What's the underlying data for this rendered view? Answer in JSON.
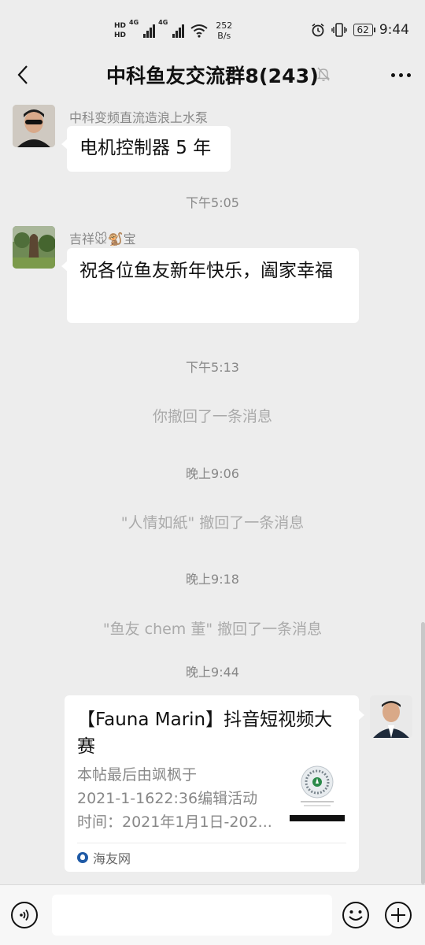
{
  "status_bar": {
    "hd1": "HD",
    "hd2": "HD",
    "net1": "4G",
    "net2": "4G",
    "speed_value": "252",
    "speed_unit": "B/s",
    "battery": "62",
    "time": "9:44",
    "icons": [
      "signal-icon",
      "wifi-icon",
      "alarm-icon",
      "vibrate-icon",
      "battery-icon"
    ]
  },
  "header": {
    "title": "中科鱼友交流群8(243)",
    "icons": [
      "back-arrow-icon",
      "mute-bell-icon",
      "more-icon"
    ]
  },
  "messages": [
    {
      "sender": "中科变频直流造浪上水泵",
      "text": "电机控制器 5 年"
    },
    {
      "time": "下午5:05"
    },
    {
      "sender": "吉祥🐭🐒宝",
      "text": "祝各位鱼友新年快乐，阖家幸福"
    },
    {
      "time": "下午5:13"
    },
    {
      "system": "你撤回了一条消息"
    },
    {
      "time": "晚上9:06"
    },
    {
      "system": "\"人情如紙\" 撤回了一条消息"
    },
    {
      "time": "晚上9:18"
    },
    {
      "system": "\"鱼友 chem 董\" 撤回了一条消息"
    },
    {
      "time": "晚上9:44"
    }
  ],
  "link_card": {
    "title": "【Fauna Marin】抖音短视频大赛",
    "desc_lines": [
      "本帖最后由飒枫于",
      "2021-1-1622:36编辑活动",
      "时间：2021年1月1日-202..."
    ],
    "source": "海友网"
  },
  "input_bar": {
    "placeholder": "",
    "icons": [
      "voice-icon",
      "emoji-icon",
      "plus-icon"
    ]
  },
  "colors": {
    "background": "#ededed",
    "bubble": "#ffffff",
    "meta_text": "#888888"
  }
}
